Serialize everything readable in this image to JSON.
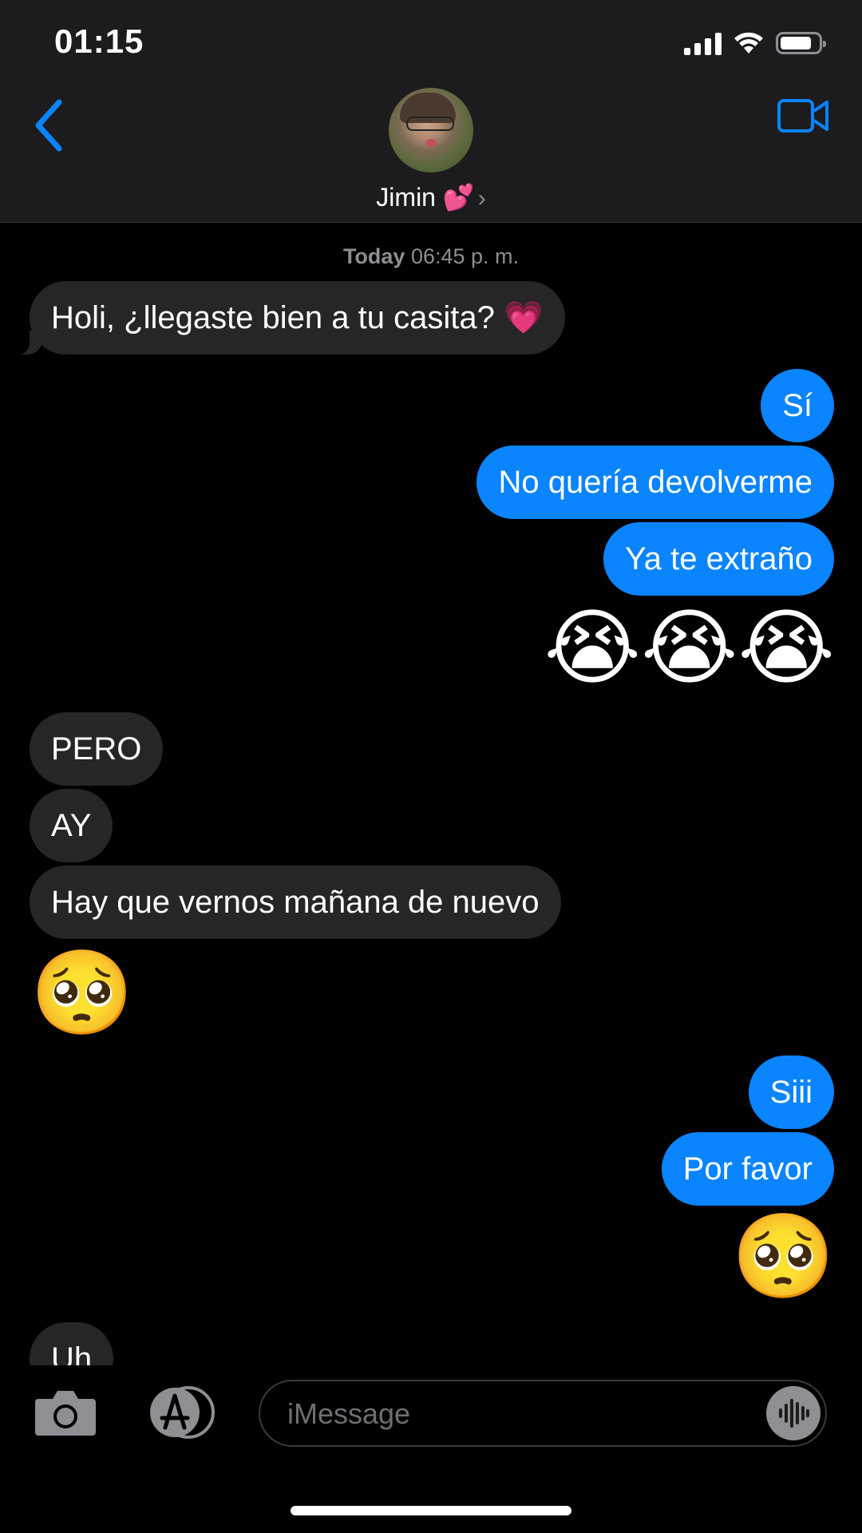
{
  "status_bar": {
    "time": "01:15"
  },
  "header": {
    "back_icon": "chevron-left-icon",
    "video_icon": "video-camera-icon",
    "contact_name": "Jimin 💕",
    "chevron": "›"
  },
  "timestamp": {
    "day": "Today",
    "time": "06:45 p. m."
  },
  "messages": [
    {
      "side": "in",
      "text": "Holi, ¿llegaste bien a tu casita? 💗"
    },
    {
      "side": "out",
      "text": "Sí"
    },
    {
      "side": "out",
      "text": "No quería devolverme"
    },
    {
      "side": "out",
      "text": "Ya te extraño"
    },
    {
      "side": "out",
      "emoji": "😭😭😭"
    },
    {
      "side": "in",
      "text": "PERO"
    },
    {
      "side": "in",
      "text": "AY"
    },
    {
      "side": "in",
      "text": "Hay que vernos mañana de nuevo"
    },
    {
      "side": "in",
      "emoji": "🥺"
    },
    {
      "side": "out",
      "text": "Siii"
    },
    {
      "side": "out",
      "text": "Por favor"
    },
    {
      "side": "out",
      "emoji": "🥺"
    },
    {
      "side": "in",
      "text": "Uh"
    }
  ],
  "composer": {
    "placeholder": "iMessage",
    "camera_icon": "camera-icon",
    "apps_icon": "app-store-icon",
    "audio_icon": "audio-waveform-icon"
  },
  "colors": {
    "accent": "#0a84ff",
    "incoming_bubble": "#262628",
    "header_bg": "#1c1c1e"
  }
}
